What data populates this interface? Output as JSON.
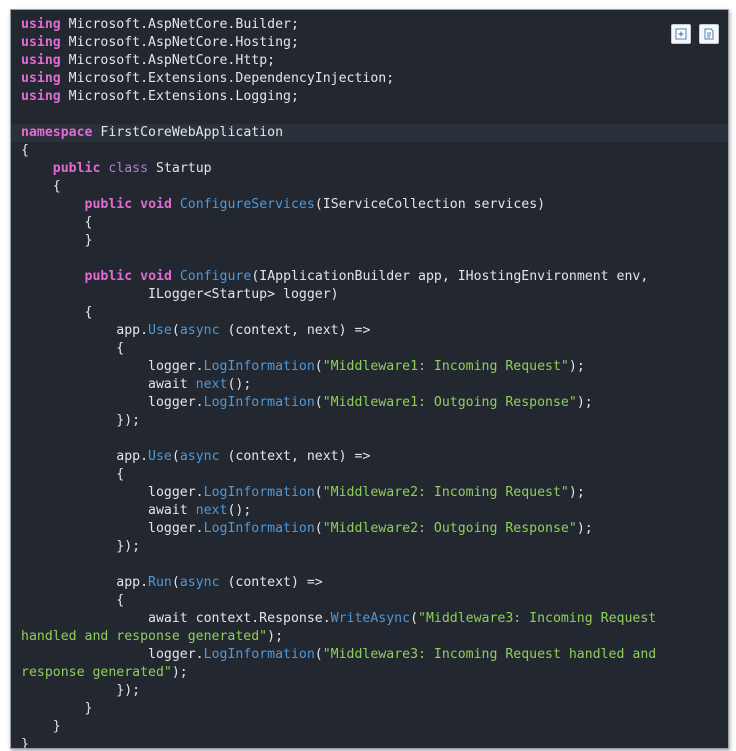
{
  "toolbar": {
    "buttons": [
      {
        "name": "expand-source-icon"
      },
      {
        "name": "view-source-icon"
      }
    ]
  },
  "code_lines": [
    [
      [
        "kw",
        "using"
      ],
      [
        "pl",
        " Microsoft.AspNetCore.Builder;"
      ]
    ],
    [
      [
        "kw",
        "using"
      ],
      [
        "pl",
        " Microsoft.AspNetCore.Hosting;"
      ]
    ],
    [
      [
        "kw",
        "using"
      ],
      [
        "pl",
        " Microsoft.AspNetCore.Http;"
      ]
    ],
    [
      [
        "kw",
        "using"
      ],
      [
        "pl",
        " Microsoft.Extensions.DependencyInjection;"
      ]
    ],
    [
      [
        "kw",
        "using"
      ],
      [
        "pl",
        " Microsoft.Extensions.Logging;"
      ]
    ],
    [],
    [
      [
        "kw",
        "namespace"
      ],
      [
        "pl",
        " FirstCoreWebApplication"
      ]
    ],
    [
      [
        "pl",
        "{"
      ]
    ],
    [
      [
        "pl",
        "    "
      ],
      [
        "kw",
        "public"
      ],
      [
        "pl",
        " "
      ],
      [
        "kw2",
        "class"
      ],
      [
        "pl",
        " Startup"
      ]
    ],
    [
      [
        "pl",
        "    {"
      ]
    ],
    [
      [
        "pl",
        "        "
      ],
      [
        "kw",
        "public"
      ],
      [
        "pl",
        " "
      ],
      [
        "kw",
        "void"
      ],
      [
        "pl",
        " "
      ],
      [
        "fn",
        "ConfigureServices"
      ],
      [
        "pl",
        "(IServiceCollection services)"
      ]
    ],
    [
      [
        "pl",
        "        {"
      ]
    ],
    [
      [
        "pl",
        "        }"
      ]
    ],
    [],
    [
      [
        "pl",
        "        "
      ],
      [
        "kw",
        "public"
      ],
      [
        "pl",
        " "
      ],
      [
        "kw",
        "void"
      ],
      [
        "pl",
        " "
      ],
      [
        "fn",
        "Configure"
      ],
      [
        "pl",
        "(IApplicationBuilder app, IHostingEnvironment env,"
      ]
    ],
    [
      [
        "pl",
        "                ILogger<Startup> logger)"
      ]
    ],
    [
      [
        "pl",
        "        {"
      ]
    ],
    [
      [
        "pl",
        "            app."
      ],
      [
        "fn",
        "Use"
      ],
      [
        "pl",
        "("
      ],
      [
        "fn",
        "async"
      ],
      [
        "pl",
        " (context, next) =>"
      ]
    ],
    [
      [
        "pl",
        "            {"
      ]
    ],
    [
      [
        "pl",
        "                logger."
      ],
      [
        "fn",
        "LogInformation"
      ],
      [
        "pl",
        "("
      ],
      [
        "str",
        "\"Middleware1: Incoming Request\""
      ],
      [
        "pl",
        ");"
      ]
    ],
    [
      [
        "pl",
        "                await "
      ],
      [
        "fn",
        "next"
      ],
      [
        "pl",
        "();"
      ]
    ],
    [
      [
        "pl",
        "                logger."
      ],
      [
        "fn",
        "LogInformation"
      ],
      [
        "pl",
        "("
      ],
      [
        "str",
        "\"Middleware1: Outgoing Response\""
      ],
      [
        "pl",
        ");"
      ]
    ],
    [
      [
        "pl",
        "            });"
      ]
    ],
    [],
    [
      [
        "pl",
        "            app."
      ],
      [
        "fn",
        "Use"
      ],
      [
        "pl",
        "("
      ],
      [
        "fn",
        "async"
      ],
      [
        "pl",
        " (context, next) =>"
      ]
    ],
    [
      [
        "pl",
        "            {"
      ]
    ],
    [
      [
        "pl",
        "                logger."
      ],
      [
        "fn",
        "LogInformation"
      ],
      [
        "pl",
        "("
      ],
      [
        "str",
        "\"Middleware2: Incoming Request\""
      ],
      [
        "pl",
        ");"
      ]
    ],
    [
      [
        "pl",
        "                await "
      ],
      [
        "fn",
        "next"
      ],
      [
        "pl",
        "();"
      ]
    ],
    [
      [
        "pl",
        "                logger."
      ],
      [
        "fn",
        "LogInformation"
      ],
      [
        "pl",
        "("
      ],
      [
        "str",
        "\"Middleware2: Outgoing Response\""
      ],
      [
        "pl",
        ");"
      ]
    ],
    [
      [
        "pl",
        "            });"
      ]
    ],
    [],
    [
      [
        "pl",
        "            app."
      ],
      [
        "fn",
        "Run"
      ],
      [
        "pl",
        "("
      ],
      [
        "fn",
        "async"
      ],
      [
        "pl",
        " (context) =>"
      ]
    ],
    [
      [
        "pl",
        "            {"
      ]
    ],
    [
      [
        "pl",
        "                await context.Response."
      ],
      [
        "fn",
        "WriteAsync"
      ],
      [
        "pl",
        "("
      ],
      [
        "str",
        "\"Middleware3: Incoming Request"
      ]
    ],
    [
      [
        "str",
        "handled and response generated\""
      ],
      [
        "pl",
        ");"
      ]
    ],
    [
      [
        "pl",
        "                logger."
      ],
      [
        "fn",
        "LogInformation"
      ],
      [
        "pl",
        "("
      ],
      [
        "str",
        "\"Middleware3: Incoming Request handled and"
      ]
    ],
    [
      [
        "str",
        "response generated\""
      ],
      [
        "pl",
        ");"
      ]
    ],
    [
      [
        "pl",
        "            });"
      ]
    ],
    [
      [
        "pl",
        "        }"
      ]
    ],
    [
      [
        "pl",
        "    }"
      ]
    ],
    [
      [
        "pl",
        "}"
      ]
    ]
  ],
  "highlighted_line": 6
}
